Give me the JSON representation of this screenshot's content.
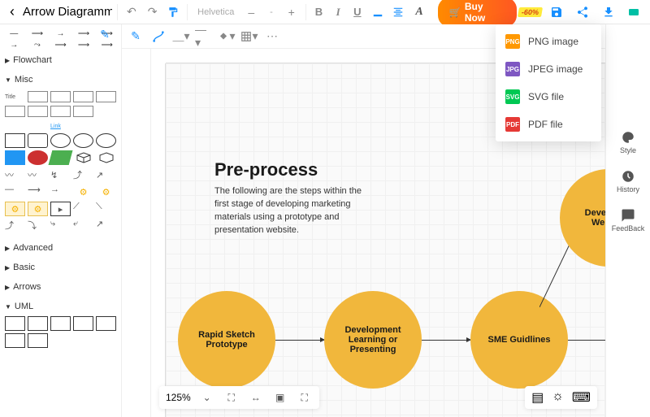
{
  "header": {
    "doc_title": "Arrow Diagramm",
    "font_family": "Helvetica",
    "font_size": "-",
    "buy_label": "Buy Now",
    "discount": "-60%"
  },
  "shape_categories": {
    "flowchart": "Flowchart",
    "misc": "Misc",
    "misc_title_label": "Title",
    "misc_link_label": "Link",
    "advanced": "Advanced",
    "basic": "Basic",
    "arrows": "Arrows",
    "uml": "UML"
  },
  "canvas": {
    "title": "Pre-process",
    "description": "The following are the steps within the first stage of developing marketing materials using a prototype and presentation website.",
    "nodes": {
      "n1": "Rapid Sketch Prototype",
      "n2": "Development Learning or Presenting",
      "n3": "SME Guidlines",
      "n4": "Developme\nWebsite"
    },
    "zoom_label": "125%"
  },
  "right_sidebar": {
    "style": "Style",
    "history": "History",
    "feedback": "FeedBack"
  },
  "export_menu": {
    "png": "PNG image",
    "jpeg": "JPEG image",
    "svg": "SVG file",
    "pdf": "PDF file"
  }
}
